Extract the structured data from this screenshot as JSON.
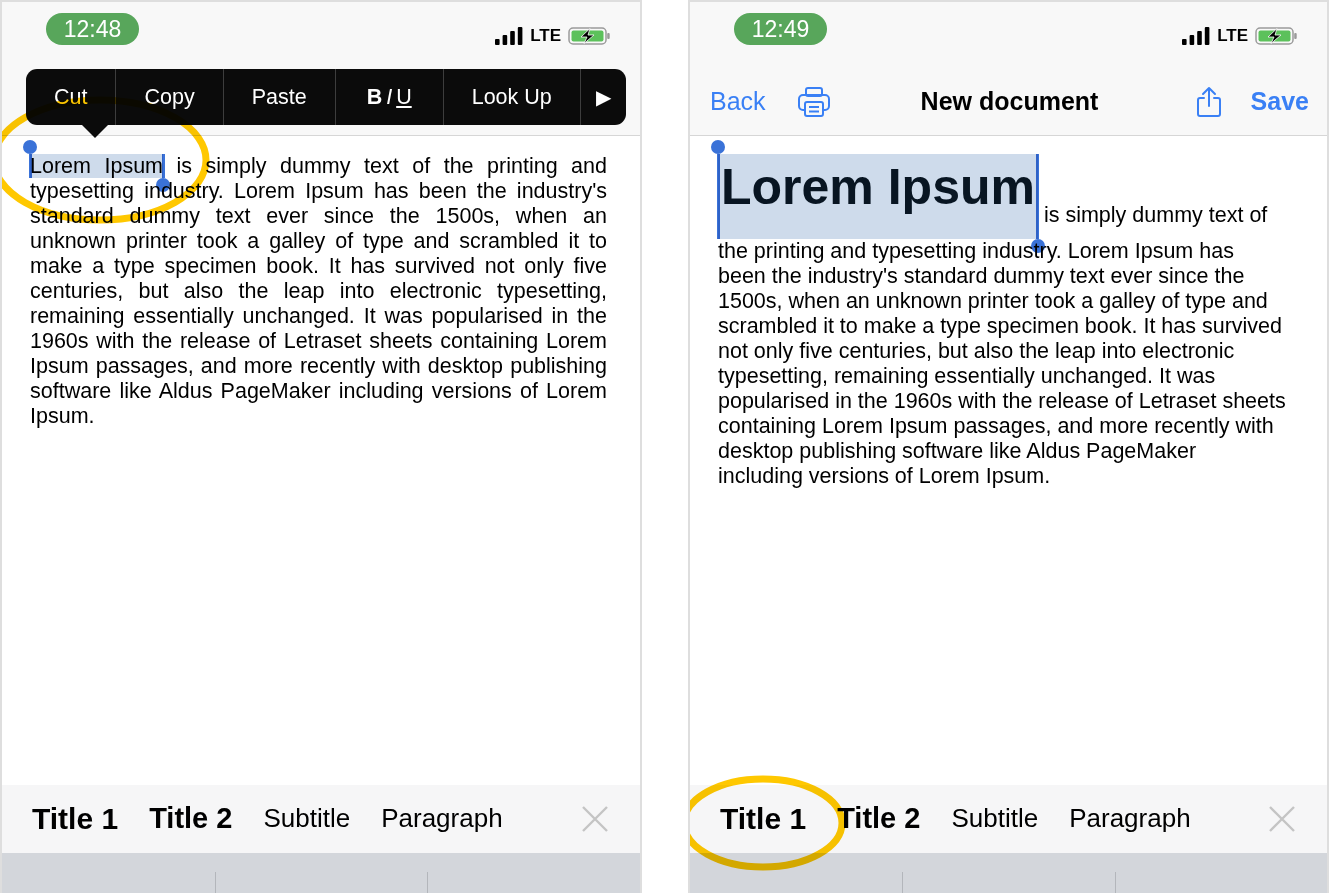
{
  "screens": [
    {
      "status_bar": {
        "time": "12:48",
        "network": "LTE"
      },
      "edit_menu": {
        "items": [
          {
            "kind": "text",
            "label": "Cut"
          },
          {
            "kind": "text",
            "label": "Copy"
          },
          {
            "kind": "text",
            "label": "Paste"
          },
          {
            "kind": "format",
            "letters": [
              "B",
              "I",
              "U"
            ]
          },
          {
            "kind": "text",
            "label": "Look Up"
          },
          {
            "kind": "more",
            "label": "▶"
          }
        ]
      },
      "document": {
        "selection": {
          "kind": "paragraph",
          "text": "Lorem Ipsum",
          "circled": true
        },
        "text": "is simply dummy text of the printing and typesetting industry. Lorem Ipsum has been the industry's standard dummy text ever since the 1500s, when an unknown printer took a galley of type and scrambled it to make a type specimen book. It has survived not only five centuries, but also the leap into electronic typesetting, remaining essentially unchanged. It was popularised in the 1960s with the release of Letraset sheets containing Lorem Ipsum passages, and more recently with desktop publishing software like Aldus PageMaker including versions of Lorem Ipsum."
      },
      "format_bar": {
        "items": [
          {
            "kind": "title1",
            "label": "Title 1",
            "circled": false
          },
          {
            "kind": "title2",
            "label": "Title 2",
            "circled": false
          },
          {
            "kind": "subtitle",
            "label": "Subtitle",
            "circled": false
          },
          {
            "kind": "paragraph",
            "label": "Paragraph",
            "circled": false
          }
        ]
      }
    },
    {
      "status_bar": {
        "time": "12:49",
        "network": "LTE"
      },
      "nav_bar": {
        "back": "Back",
        "title": "New document",
        "save": "Save"
      },
      "document": {
        "selection": {
          "kind": "title1",
          "text": "Lorem Ipsum",
          "circled": false
        },
        "text": "is simply dummy text of the printing and typesetting industry. Lorem Ipsum has been the industry's standard dummy text ever since the 1500s, when an unknown printer took a galley of type and scrambled it to make a type specimen book. It has survived not only five centuries, but also the leap into electronic typesetting, remaining essentially unchanged. It was popularised in the 1960s with the release of Letraset sheets containing Lorem Ipsum passages, and more recently with desktop publishing software like Aldus PageMaker including versions of Lorem Ipsum."
      },
      "format_bar": {
        "items": [
          {
            "kind": "title1",
            "label": "Title 1",
            "circled": true
          },
          {
            "kind": "title2",
            "label": "Title 2",
            "circled": false
          },
          {
            "kind": "subtitle",
            "label": "Subtitle",
            "circled": false
          },
          {
            "kind": "paragraph",
            "label": "Paragraph",
            "circled": false
          }
        ]
      }
    }
  ]
}
